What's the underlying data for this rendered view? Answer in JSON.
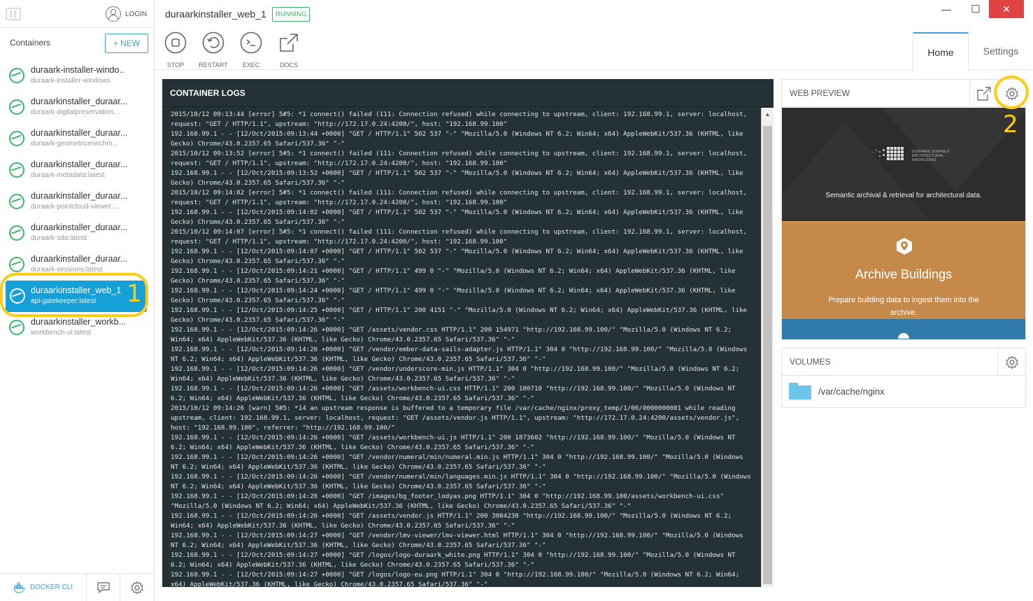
{
  "sidebar": {
    "login_label": "LOGIN",
    "title": "Containers",
    "new_label": "NEW",
    "containers": [
      {
        "name": "duraark-installer-windo..",
        "image": "duraark-installer-windows"
      },
      {
        "name": "duraarkinstaller_duraar...",
        "image": "duraark-digitalpreservation..."
      },
      {
        "name": "duraarkinstaller_duraar...",
        "image": "duraark-geometricenrichm..."
      },
      {
        "name": "duraarkinstaller_duraar...",
        "image": "duraark-metadata:latest"
      },
      {
        "name": "duraarkinstaller_duraar...",
        "image": "duraark-pointcloud-viewer:..."
      },
      {
        "name": "duraarkinstaller_duraar...",
        "image": "duraark-sda:latest"
      },
      {
        "name": "duraarkinstaller_duraar...",
        "image": "duraark-sessions:latest"
      },
      {
        "name": "duraarkinstaller_web_1",
        "image": "api-gatekeeper:latest"
      },
      {
        "name": "duraarkinstaller_workb...",
        "image": "workbench-ui:latest"
      }
    ],
    "annotation1": "1",
    "docker_cli_label": "DOCKER CLI"
  },
  "header": {
    "container_title": "duraarkinstaller_web_1",
    "status": "RUNNING",
    "actions": {
      "stop": "STOP",
      "restart": "RESTART",
      "exec": "EXEC",
      "docs": "DOCS"
    },
    "window": {
      "minimize": "—",
      "maximize": "☐",
      "close": "✕"
    },
    "tabs": {
      "home": "Home",
      "settings": "Settings"
    }
  },
  "logs": {
    "title": "CONTAINER LOGS",
    "lines": [
      "2015/10/12 09:13:44 [error] 5#5: *1 connect() failed (111: Connection refused) while connecting to upstream, client: 192.168.99.1, server: localhost,",
      "request: \"GET / HTTP/1.1\", upstream: \"http://172.17.0.24:4200/\", host: \"192.168.99.100\"",
      "192.168.99.1 - - [12/Oct/2015:09:13:44 +0000] \"GET / HTTP/1.1\" 502 537 \"-\" \"Mozilla/5.0 (Windows NT 6.2; Win64; x64) AppleWebKit/537.36 (KHTML, like",
      "Gecko) Chrome/43.0.2357.65 Safari/537.36\" \"-\"",
      "2015/10/12 09:13:52 [error] 5#5: *1 connect() failed (111: Connection refused) while connecting to upstream, client: 192.168.99.1, server: localhost,",
      "request: \"GET / HTTP/1.1\", upstream: \"http://172.17.0.24:4200/\", host: \"192.168.99.100\"",
      "192.168.99.1 - - [12/Oct/2015:09:13:52 +0000] \"GET / HTTP/1.1\" 502 537 \"-\" \"Mozilla/5.0 (Windows NT 6.2; Win64; x64) AppleWebKit/537.36 (KHTML, like",
      "Gecko) Chrome/43.0.2357.65 Safari/537.36\" \"-\"",
      "2015/10/12 09:14:02 [error] 5#5: *1 connect() failed (111: Connection refused) while connecting to upstream, client: 192.168.99.1, server: localhost,",
      "request: \"GET / HTTP/1.1\", upstream: \"http://172.17.0.24:4200/\", host: \"192.168.99.100\"",
      "192.168.99.1 - - [12/Oct/2015:09:14:02 +0000] \"GET / HTTP/1.1\" 502 537 \"-\" \"Mozilla/5.0 (Windows NT 6.2; Win64; x64) AppleWebKit/537.36 (KHTML, like",
      "Gecko) Chrome/43.0.2357.65 Safari/537.36\" \"-\"",
      "2015/10/12 09:14:07 [error] 5#5: *1 connect() failed (111: Connection refused) while connecting to upstream, client: 192.168.99.1, server: localhost,",
      "request: \"GET / HTTP/1.1\", upstream: \"http://172.17.0.24:4200/\", host: \"192.168.99.100\"",
      "192.168.99.1 - - [12/Oct/2015:09:14:07 +0000] \"GET / HTTP/1.1\" 502 537 \"-\" \"Mozilla/5.0 (Windows NT 6.2; Win64; x64) AppleWebKit/537.36 (KHTML, like",
      "Gecko) Chrome/43.0.2357.65 Safari/537.36\" \"-\"",
      "192.168.99.1 - - [12/Oct/2015:09:14:21 +0000] \"GET / HTTP/1.1\" 499 0 \"-\" \"Mozilla/5.0 (Windows NT 6.2; Win64; x64) AppleWebKit/537.36 (KHTML, like",
      "Gecko) Chrome/43.0.2357.65 Safari/537.36\" \"-\"",
      "192.168.99.1 - - [12/Oct/2015:09:14:24 +0000] \"GET / HTTP/1.1\" 499 0 \"-\" \"Mozilla/5.0 (Windows NT 6.2; Win64; x64) AppleWebKit/537.36 (KHTML, like",
      "Gecko) Chrome/43.0.2357.65 Safari/537.36\" \"-\"",
      "192.168.99.1 - - [12/Oct/2015:09:14:25 +0000] \"GET / HTTP/1.1\" 200 4151 \"-\" \"Mozilla/5.0 (Windows NT 6.2; Win64; x64) AppleWebKit/537.36 (KHTML, like",
      "Gecko) Chrome/43.0.2357.65 Safari/537.36\" \"-\"",
      "192.168.99.1 - - [12/Oct/2015:09:14:26 +0000] \"GET /assets/vendor.css HTTP/1.1\" 200 154971 \"http://192.168.99.100/\" \"Mozilla/5.0 (Windows NT 6.2;",
      "Win64; x64) AppleWebKit/537.36 (KHTML, like Gecko) Chrome/43.0.2357.65 Safari/537.36\" \"-\"",
      "192.168.99.1 - - [12/Oct/2015:09:14:26 +0000] \"GET /vendor/ember-data-sails-adapter.js HTTP/1.1\" 304 0 \"http://192.168.99.100/\" \"Mozilla/5.0 (Windows",
      "NT 6.2; Win64; x64) AppleWebKit/537.36 (KHTML, like Gecko) Chrome/43.0.2357.65 Safari/537.36\" \"-\"",
      "192.168.99.1 - - [12/Oct/2015:09:14:26 +0000] \"GET /vendor/underscore-min.js HTTP/1.1\" 304 0 \"http://192.168.99.100/\" \"Mozilla/5.0 (Windows NT 6.2;",
      "Win64; x64) AppleWebKit/537.36 (KHTML, like Gecko) Chrome/43.0.2357.65 Safari/537.36\" \"-\"",
      "192.168.99.1 - - [12/Oct/2015:09:14:26 +0000] \"GET /assets/workbench-ui.css HTTP/1.1\" 200 100710 \"http://192.168.99.100/\" \"Mozilla/5.0 (Windows NT",
      "6.2; Win64; x64) AppleWebKit/537.36 (KHTML, like Gecko) Chrome/43.0.2357.65 Safari/537.36\" \"-\"",
      "2015/10/12 09:14:26 [warn] 5#5: *14 an upstream response is buffered to a temporary file /var/cache/nginx/proxy_temp/1/00/0000000001 while reading",
      "upstream, client: 192.168.99.1, server: localhost, request: \"GET /assets/vendor.js HTTP/1.1\", upstream: \"http://172.17.0.24:4200/assets/vendor.js\",",
      "host: \"192.168.99.100\", referrer: \"http://192.168.99.100/\"",
      "192.168.99.1 - - [12/Oct/2015:09:14:26 +0000] \"GET /assets/workbench-ui.js HTTP/1.1\" 200 1873602 \"http://192.168.99.100/\" \"Mozilla/5.0 (Windows NT",
      "6.2; Win64; x64) AppleWebKit/537.36 (KHTML, like Gecko) Chrome/43.0.2357.65 Safari/537.36\" \"-\"",
      "192.168.99.1 - - [12/Oct/2015:09:14:26 +0000] \"GET /vendor/numeral/min/numeral.min.js HTTP/1.1\" 304 0 \"http://192.168.99.100/\" \"Mozilla/5.0 (Windows",
      "NT 6.2; Win64; x64) AppleWebKit/537.36 (KHTML, like Gecko) Chrome/43.0.2357.65 Safari/537.36\" \"-\"",
      "192.168.99.1 - - [12/Oct/2015:09:14:26 +0000] \"GET /vendor/numeral/min/languages.min.js HTTP/1.1\" 304 0 \"http://192.168.99.100/\" \"Mozilla/5.0 (Windows",
      "NT 6.2; Win64; x64) AppleWebKit/537.36 (KHTML, like Gecko) Chrome/43.0.2357.65 Safari/537.36\" \"-\"",
      "192.168.99.1 - - [12/Oct/2015:09:14:26 +0000] \"GET /images/bg_footer_lodyas.png HTTP/1.1\" 304 0 \"http://192.168.99.100/assets/workbench-ui.css\"",
      "\"Mozilla/5.0 (Windows NT 6.2; Win64; x64) AppleWebKit/537.36 (KHTML, like Gecko) Chrome/43.0.2357.65 Safari/537.36\" \"-\"",
      "192.168.99.1 - - [12/Oct/2015:09:14:26 +0000] \"GET /assets/vendor.js HTTP/1.1\" 200 3004230 \"http://192.168.99.100/\" \"Mozilla/5.0 (Windows NT 6.2;",
      "Win64; x64) AppleWebKit/537.36 (KHTML, like Gecko) Chrome/43.0.2357.65 Safari/537.36\" \"-\"",
      "192.168.99.1 - - [12/Oct/2015:09:14:27 +0000] \"GET /vendor/lmv-viewer/lmv-viewer.html HTTP/1.1\" 304 0 \"http://192.168.99.100/\" \"Mozilla/5.0 (Windows",
      "NT 6.2; Win64; x64) AppleWebKit/537.36 (KHTML, like Gecko) Chrome/43.0.2357.65 Safari/537.36\" \"-\"",
      "192.168.99.1 - - [12/Oct/2015:09:14:27 +0000] \"GET /logos/logo-duraark_white.png HTTP/1.1\" 304 0 \"http://192.168.99.100/\" \"Mozilla/5.0 (Windows NT",
      "6.2; Win64; x64) AppleWebKit/537.36 (KHTML, like Gecko) Chrome/43.0.2357.65 Safari/537.36\" \"-\"",
      "192.168.99.1 - - [12/Oct/2015:09:14:27 +0000] \"GET /logos/logo-eu.png HTTP/1.1\" 304 0 \"http://192.168.99.100/\" \"Mozilla/5.0 (Windows NT 6.2; Win64;",
      "x64) AppleWebKit/537.36 (KHTML, like Gecko) Chrome/43.0.2357.65 Safari/537.36\" \"-\""
    ]
  },
  "web_preview": {
    "title": "WEB PREVIEW",
    "annotation2": "2",
    "page": {
      "logo_text": "DURAARK DURABLE ARCHITECTURAL KNOWLEDGE",
      "tagline": "Semantic archival & retrieval for architectural data.",
      "heading": "Archive Buildings",
      "description": "Prepare building data to ingest them into the archive."
    }
  },
  "volumes": {
    "title": "VOLUMES",
    "items": [
      {
        "path": "/var/cache/nginx"
      }
    ]
  },
  "colors": {
    "accent": "#3ba3d5",
    "running": "#3bb56b",
    "active_item": "#16a0d8",
    "log_bg": "#243136",
    "annotation": "#ffcc14",
    "close": "#e04343"
  }
}
